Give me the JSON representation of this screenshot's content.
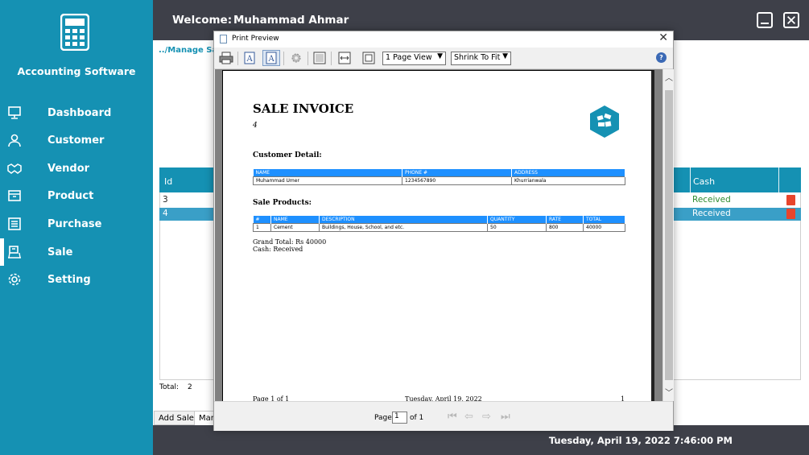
{
  "app": {
    "title": "Accounting Software",
    "welcome_label": "Welcome:",
    "user_name": "Muhammad Ahmar",
    "datetime": "Tuesday, April 19, 2022 7:46:00 PM",
    "accent_color": "#1591b3",
    "topbar_color": "#3e4049"
  },
  "sidebar": {
    "items": [
      {
        "label": "Dashboard",
        "icon": "monitor-icon"
      },
      {
        "label": "Customer",
        "icon": "user-icon"
      },
      {
        "label": "Vendor",
        "icon": "handshake-icon"
      },
      {
        "label": "Product",
        "icon": "box-icon"
      },
      {
        "label": "Purchase",
        "icon": "register-icon"
      },
      {
        "label": "Sale",
        "icon": "cash-register-icon",
        "active": true
      },
      {
        "label": "Setting",
        "icon": "gear-icon"
      }
    ]
  },
  "main": {
    "breadcrumb": "../Manage Sal",
    "grid": {
      "columns": [
        "Id",
        "Cash"
      ],
      "rows": [
        {
          "id": "3",
          "cash": "Received"
        },
        {
          "id": "4",
          "cash": "Received",
          "selected": true
        }
      ]
    },
    "total_label": "Total:",
    "total_value": "2",
    "tabs": [
      "Add Sale",
      "Man"
    ]
  },
  "dialog": {
    "title": "Print Preview",
    "view_mode": "1 Page View",
    "zoom_mode": "Shrink To Fit",
    "page_label": "Page",
    "page_value": "1",
    "of_label": "of 1",
    "document": {
      "title": "SALE INVOICE",
      "invoice_no": "4",
      "customer_section": "Customer Detail:",
      "customer_headers": [
        "NAME",
        "PHONE #",
        "ADDRESS"
      ],
      "customer_row": [
        "Muhammad Umer",
        "1234567890",
        "Khurrianwala"
      ],
      "products_section": "Sale Products:",
      "product_headers": [
        "#",
        "NAME",
        "DESCRIPTION",
        "QUANTITY",
        "RATE",
        "TOTAL"
      ],
      "product_rows": [
        [
          "1",
          "Cement",
          "Buildings, House, School, and etc.",
          "50",
          "800",
          "40000"
        ]
      ],
      "grand_total": "Grand Total: Rs 40000",
      "cash_status": "Cash: Received",
      "footer_page": "Page 1 of 1",
      "footer_date": "Tuesday, April 19, 2022",
      "footer_num": "1"
    }
  }
}
